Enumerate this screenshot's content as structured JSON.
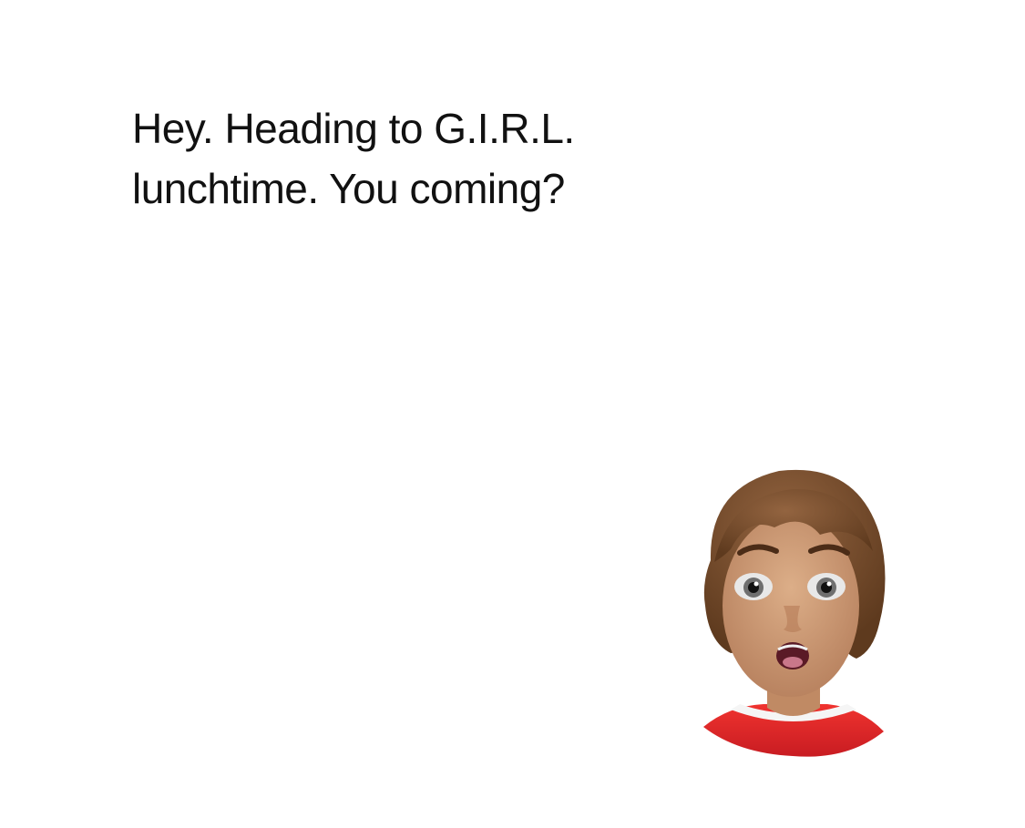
{
  "message": {
    "lines": [
      "Hey. Heading to G.I.R.L.",
      "lunchtime. You coming?"
    ]
  },
  "avatar": {
    "icon": "surprised-girl-avatar-icon",
    "colors": {
      "hair": "#7a4f2c",
      "skin": "#c99670",
      "shirt": "#e0262b",
      "collar": "#ffffff"
    }
  }
}
